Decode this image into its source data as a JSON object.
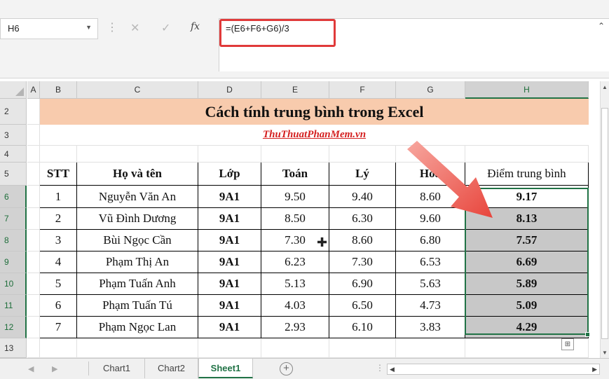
{
  "formula_bar": {
    "name_box": "H6",
    "cancel_icon": "✕",
    "enter_icon": "✓",
    "fx_label": "fx",
    "formula": "=(E6+F6+G6)/3"
  },
  "columns": [
    "A",
    "B",
    "C",
    "D",
    "E",
    "F",
    "G",
    "H"
  ],
  "selected_column": "H",
  "row_numbers": [
    "2",
    "3",
    "4",
    "5",
    "6",
    "7",
    "8",
    "9",
    "10",
    "11",
    "12",
    "13"
  ],
  "title": "Cách tính trung bình trong Excel",
  "subtitle": "ThuThuatPhanMem.vn",
  "table": {
    "headers": [
      "STT",
      "Họ và tên",
      "Lớp",
      "Toán",
      "Lý",
      "Hóa",
      "Điểm trung bình"
    ],
    "rows": [
      [
        "1",
        "Nguyễn Văn An",
        "9A1",
        "9.50",
        "9.40",
        "8.60",
        "9.17"
      ],
      [
        "2",
        "Vũ Đình Dương",
        "9A1",
        "8.50",
        "6.30",
        "9.60",
        "8.13"
      ],
      [
        "3",
        "Bùi Ngọc Cần",
        "9A1",
        "7.30",
        "8.60",
        "6.80",
        "7.57"
      ],
      [
        "4",
        "Phạm Thị An",
        "9A1",
        "6.23",
        "7.30",
        "6.53",
        "6.69"
      ],
      [
        "5",
        "Phạm Tuấn Anh",
        "9A1",
        "5.13",
        "6.90",
        "5.63",
        "5.89"
      ],
      [
        "6",
        "Phạm Tuấn Tú",
        "9A1",
        "4.03",
        "6.50",
        "4.73",
        "5.09"
      ],
      [
        "7",
        "Phạm Ngọc Lan",
        "9A1",
        "2.93",
        "6.10",
        "3.83",
        "4.29"
      ]
    ]
  },
  "sheet_tabs": {
    "tabs": [
      "Chart1",
      "Chart2",
      "Sheet1"
    ],
    "active": "Sheet1",
    "add_icon": "+"
  },
  "colors": {
    "title_fill": "#f8cbad",
    "subtitle_text": "#d42020",
    "selection_border": "#217346",
    "result_fill": "#c8c8c8",
    "arrow": "#e8453c",
    "formula_highlight": "#e03a3a"
  }
}
